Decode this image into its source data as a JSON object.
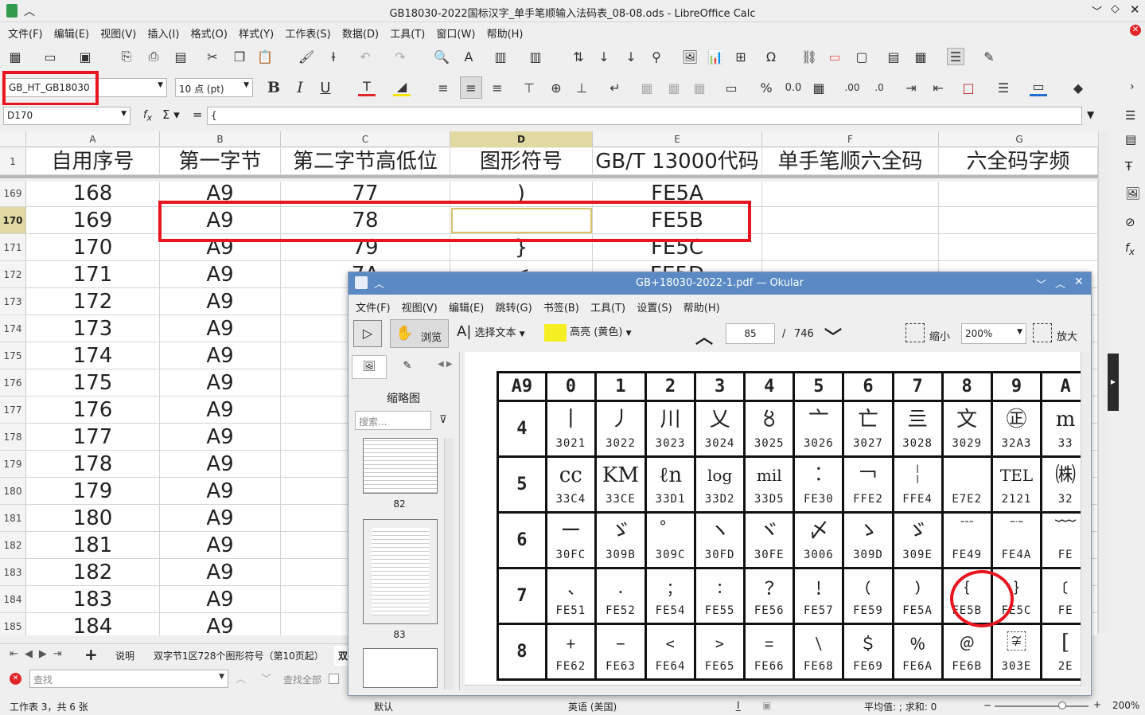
{
  "calc": {
    "window_title": "GB18030-2022国标汉字_单手笔顺输入法码表_08-08.ods - LibreOffice Calc",
    "menu": [
      "文件(F)",
      "编辑(E)",
      "视图(V)",
      "插入(I)",
      "格式(O)",
      "样式(Y)",
      "工作表(S)",
      "数据(D)",
      "工具(T)",
      "窗口(W)",
      "帮助(H)"
    ],
    "font_name": "GB_HT_GB18030",
    "font_size": "10 点 (pt)",
    "name_box": "D170",
    "formula_value": "{",
    "columns": [
      {
        "id": "A",
        "w": 168
      },
      {
        "id": "B",
        "w": 152
      },
      {
        "id": "C",
        "w": 213
      },
      {
        "id": "D",
        "w": 179
      },
      {
        "id": "E",
        "w": 213
      },
      {
        "id": "F",
        "w": 222
      },
      {
        "id": "G",
        "w": 203
      }
    ],
    "header_row_num": "1",
    "headers": [
      "自用序号",
      "第一字节",
      "第二字节高低位",
      "图形符号",
      "GB/T 13000代码",
      "单手笔顺六全码",
      "六全码字频"
    ],
    "rows": [
      {
        "n": "169",
        "a": "168",
        "b": "A9",
        "c": "77",
        "d": ")",
        "e": "FE5A"
      },
      {
        "n": "170",
        "a": "169",
        "b": "A9",
        "c": "78",
        "d": "",
        "e": "FE5B"
      },
      {
        "n": "171",
        "a": "170",
        "b": "A9",
        "c": "79",
        "d": "}",
        "e": "FE5C"
      },
      {
        "n": "172",
        "a": "171",
        "b": "A9",
        "c": "7A",
        "d": "<",
        "e": "FE5D"
      },
      {
        "n": "173",
        "a": "172",
        "b": "A9",
        "c": "",
        "d": "",
        "e": ""
      },
      {
        "n": "174",
        "a": "173",
        "b": "A9",
        "c": "",
        "d": "",
        "e": ""
      },
      {
        "n": "175",
        "a": "174",
        "b": "A9",
        "c": "",
        "d": "",
        "e": ""
      },
      {
        "n": "176",
        "a": "175",
        "b": "A9",
        "c": "",
        "d": "",
        "e": ""
      },
      {
        "n": "177",
        "a": "176",
        "b": "A9",
        "c": "",
        "d": "",
        "e": ""
      },
      {
        "n": "178",
        "a": "177",
        "b": "A9",
        "c": "",
        "d": "",
        "e": ""
      },
      {
        "n": "179",
        "a": "178",
        "b": "A9",
        "c": "",
        "d": "",
        "e": ""
      },
      {
        "n": "180",
        "a": "179",
        "b": "A9",
        "c": "",
        "d": "",
        "e": ""
      },
      {
        "n": "181",
        "a": "180",
        "b": "A9",
        "c": "",
        "d": "",
        "e": ""
      },
      {
        "n": "182",
        "a": "181",
        "b": "A9",
        "c": "",
        "d": "",
        "e": ""
      },
      {
        "n": "183",
        "a": "182",
        "b": "A9",
        "c": "",
        "d": "",
        "e": ""
      },
      {
        "n": "184",
        "a": "183",
        "b": "A9",
        "c": "",
        "d": "",
        "e": ""
      },
      {
        "n": "185",
        "a": "184",
        "b": "A9",
        "c": "",
        "d": "",
        "e": ""
      }
    ],
    "sheet_tabs": [
      "说明",
      "双字节1区728个图形符号（第10页起）",
      "双"
    ],
    "find_placeholder": "查找",
    "find_all": "查找全部",
    "status_sheet": "工作表 3，共 6 张",
    "status_style": "默认",
    "status_lang": "英语 (美国)",
    "status_sum": "平均值: ; 求和: 0",
    "status_zoom": "200%"
  },
  "okular": {
    "window_title": "GB+18030-2022-1.pdf — Okular",
    "menu": [
      "文件(F)",
      "视图(V)",
      "编辑(E)",
      "跳转(G)",
      "书签(B)",
      "工具(T)",
      "设置(S)",
      "帮助(H)"
    ],
    "browse": "浏览",
    "select_text": "选择文本",
    "highlight": "高亮 (黄色)",
    "page": "85",
    "page_total": "746",
    "zoom_out": "缩小",
    "zoom": "200%",
    "zoom_in": "放大",
    "thumbnails_title": "缩略图",
    "search_placeholder": "搜索...",
    "thumb_labels": [
      "82",
      "83"
    ],
    "table": {
      "corner": "A9",
      "col_heads": [
        "0",
        "1",
        "2",
        "3",
        "4",
        "5",
        "6",
        "7",
        "8",
        "9",
        "A"
      ],
      "rows": [
        {
          "label": "4",
          "glyphs": [
            "丨",
            "丿",
            "川",
            "乂",
            "〥",
            "亠",
            "亡",
            "亖",
            "文",
            "㊣",
            "m"
          ],
          "codes": [
            "3021",
            "3022",
            "3023",
            "3024",
            "3025",
            "3026",
            "3027",
            "3028",
            "3029",
            "32A3",
            "33"
          ]
        },
        {
          "label": "5",
          "glyphs": [
            "cc",
            "KM",
            "ℓn",
            "log",
            "mil",
            "︰",
            "￢",
            "￤",
            "",
            "TEL",
            "㈱"
          ],
          "codes": [
            "33C4",
            "33CE",
            "33D1",
            "33D2",
            "33D5",
            "FE30",
            "FFE2",
            "FFE4",
            "E7E2",
            "2121",
            "32"
          ]
        },
        {
          "label": "6",
          "glyphs": [
            "ー",
            "ゞ",
            "゜",
            "ヽ",
            "ヾ",
            "〆",
            "ゝ",
            "ゞ",
            "﹉",
            "﹊",
            "﹋"
          ],
          "codes": [
            "30FC",
            "309B",
            "309C",
            "30FD",
            "30FE",
            "3006",
            "309D",
            "309E",
            "FE49",
            "FE4A",
            "FE"
          ]
        },
        {
          "label": "7",
          "glyphs": [
            "﹑",
            "﹒",
            "﹔",
            "﹕",
            "﹖",
            "﹗",
            "﹙",
            "﹚",
            "﹛",
            "﹜",
            "﹝"
          ],
          "codes": [
            "FE51",
            "FE52",
            "FE54",
            "FE55",
            "FE56",
            "FE57",
            "FE59",
            "FE5A",
            "FE5B",
            "FE5C",
            "FE"
          ]
        },
        {
          "label": "8",
          "glyphs": [
            "﹢",
            "﹣",
            "﹤",
            "﹥",
            "﹦",
            "﹨",
            "﹩",
            "﹪",
            "﹫",
            "〾",
            "["
          ],
          "codes": [
            "FE62",
            "FE63",
            "FE64",
            "FE65",
            "FE66",
            "FE68",
            "FE69",
            "FE6A",
            "FE6B",
            "303E",
            "2E"
          ]
        }
      ]
    }
  },
  "colors": {
    "red": "#e8141e",
    "selection": "#e2d9a2",
    "okular_title": "#5a89c3"
  }
}
